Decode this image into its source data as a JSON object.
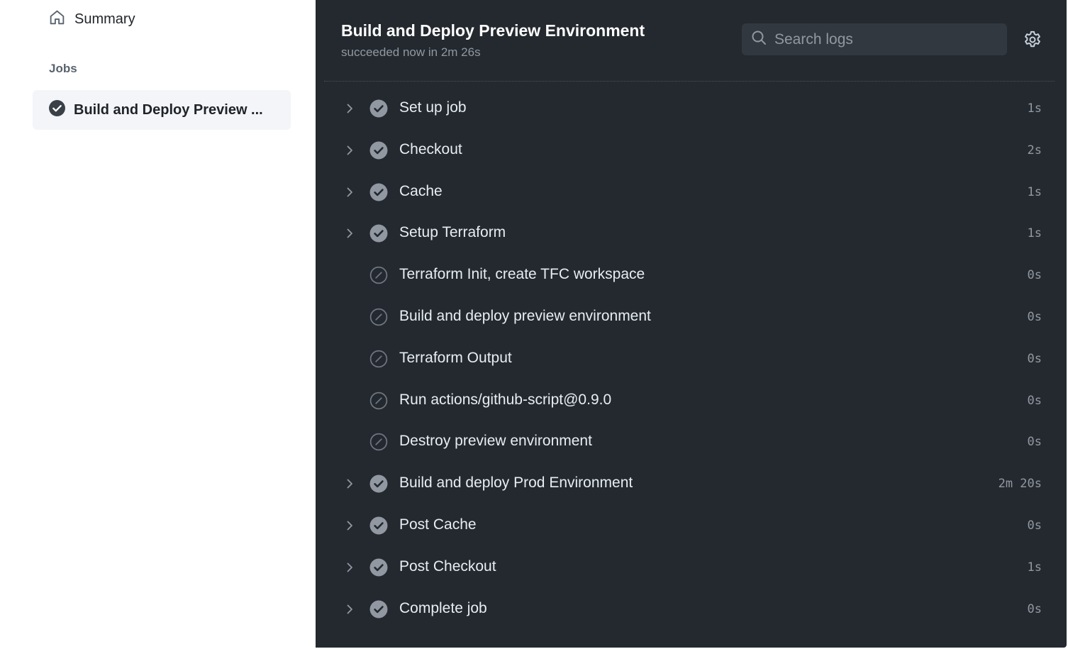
{
  "sidebar": {
    "summary_label": "Summary",
    "summary_icon": "home-icon",
    "jobs_heading": "Jobs",
    "job": {
      "label": "Build and Deploy Preview ...",
      "status_icon": "check-circle-icon"
    }
  },
  "panel": {
    "title": "Build and Deploy Preview Environment",
    "subtitle": "succeeded now in 2m 26s",
    "search": {
      "placeholder": "Search logs",
      "value": ""
    },
    "settings_icon": "gear-icon"
  },
  "steps": [
    {
      "name": "Set up job",
      "duration": "1s",
      "status": "success",
      "expandable": true
    },
    {
      "name": "Checkout",
      "duration": "2s",
      "status": "success",
      "expandable": true
    },
    {
      "name": "Cache",
      "duration": "1s",
      "status": "success",
      "expandable": true
    },
    {
      "name": "Setup Terraform",
      "duration": "1s",
      "status": "success",
      "expandable": true
    },
    {
      "name": "Terraform Init, create TFC workspace",
      "duration": "0s",
      "status": "skipped",
      "expandable": false
    },
    {
      "name": "Build and deploy preview environment",
      "duration": "0s",
      "status": "skipped",
      "expandable": false
    },
    {
      "name": "Terraform Output",
      "duration": "0s",
      "status": "skipped",
      "expandable": false
    },
    {
      "name": "Run actions/github-script@0.9.0",
      "duration": "0s",
      "status": "skipped",
      "expandable": false
    },
    {
      "name": "Destroy preview environment",
      "duration": "0s",
      "status": "skipped",
      "expandable": false
    },
    {
      "name": "Build and deploy Prod Environment",
      "duration": "2m 20s",
      "status": "success",
      "expandable": true
    },
    {
      "name": "Post Cache",
      "duration": "0s",
      "status": "success",
      "expandable": true
    },
    {
      "name": "Post Checkout",
      "duration": "1s",
      "status": "success",
      "expandable": true
    },
    {
      "name": "Complete job",
      "duration": "0s",
      "status": "success",
      "expandable": true
    }
  ],
  "colors": {
    "panel_bg": "#24292f",
    "success_icon": "#9198a1",
    "skipped_icon": "#6e7681",
    "step_text": "#e6edf3",
    "duration_text": "#9198a1"
  }
}
